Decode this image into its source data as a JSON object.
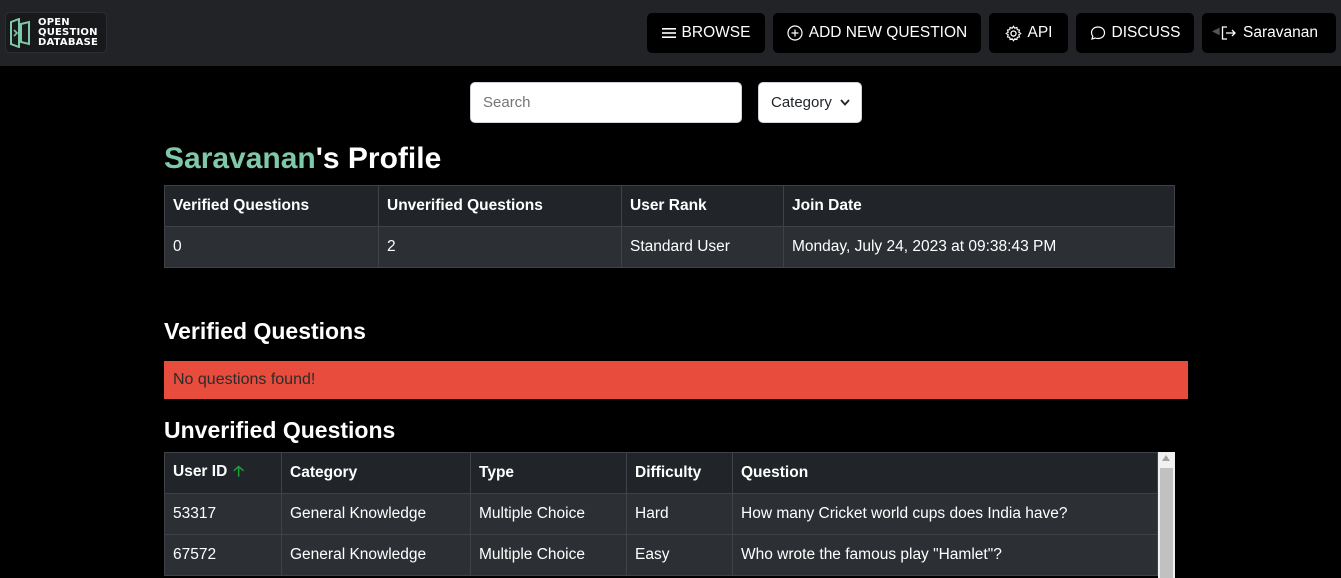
{
  "nav": {
    "logo_lines": [
      "OPEN",
      "QUESTION",
      "DATABASE"
    ],
    "browse": "BROWSE",
    "add_question": "ADD NEW QUESTION",
    "api": "API",
    "discuss": "DISCUSS",
    "user": "Saravanan"
  },
  "search": {
    "placeholder": "Search",
    "category_selected": "Category"
  },
  "profile": {
    "username": "Saravanan",
    "title_suffix": "'s Profile",
    "stats_headers": [
      "Verified Questions",
      "Unverified Questions",
      "User Rank",
      "Join Date"
    ],
    "stats_values": [
      "0",
      "2",
      "Standard User",
      "Monday, July 24, 2023 at 09:38:43 PM"
    ]
  },
  "verified": {
    "title": "Verified Questions",
    "empty_message": "No questions found!"
  },
  "unverified": {
    "title": "Unverified Questions",
    "headers": [
      "User ID",
      "Category",
      "Type",
      "Difficulty",
      "Question"
    ],
    "rows": [
      [
        "53317",
        "General Knowledge",
        "Multiple Choice",
        "Hard",
        "How many Cricket world cups does India have?"
      ],
      [
        "67572",
        "General Knowledge",
        "Multiple Choice",
        "Easy",
        "Who wrote the famous play \"Hamlet\"?"
      ]
    ]
  },
  "colors": {
    "username_accent": "#7fc8a9",
    "alert_bg": "#e74c3c",
    "sort_arrow": "#1e9e3a"
  }
}
